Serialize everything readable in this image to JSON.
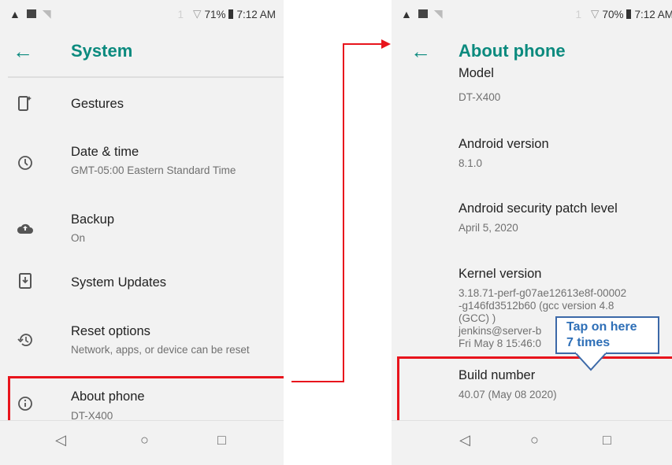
{
  "left_screen": {
    "status": {
      "battery": "71%",
      "time": "7:12 AM",
      "notif": "1"
    },
    "title": "System",
    "items": [
      {
        "icon": "gestures-icon",
        "title": "Gestures",
        "subtitle": ""
      },
      {
        "icon": "clock-icon",
        "title": "Date & time",
        "subtitle": "GMT-05:00 Eastern Standard Time"
      },
      {
        "icon": "cloud-upload-icon",
        "title": "Backup",
        "subtitle": "On"
      },
      {
        "icon": "system-update-icon",
        "title": "System Updates",
        "subtitle": ""
      },
      {
        "icon": "restore-icon",
        "title": "Reset options",
        "subtitle": "Network, apps, or device can be reset"
      },
      {
        "icon": "info-icon",
        "title": "About phone",
        "subtitle": "DT-X400"
      }
    ]
  },
  "right_screen": {
    "status": {
      "battery": "70%",
      "time": "7:12 AM",
      "notif": "1"
    },
    "title": "About phone",
    "model_label": "Model",
    "model_value": "DT-X400",
    "android_version_label": "Android version",
    "android_version_value": "8.1.0",
    "patch_label": "Android security patch level",
    "patch_value": "April 5, 2020",
    "kernel_label": "Kernel version",
    "kernel_lines": [
      "3.18.71-perf-g07ae12613e8f-00002",
      "-g146fd3512b60 (gcc version 4.8",
      "(GCC) )",
      "jenkins@server-b",
      "Fri May 8 15:46:0"
    ],
    "build_label": "Build number",
    "build_value": "40.07 (May 08 2020)"
  },
  "callout": {
    "line1": "Tap on here",
    "line2": "7 times"
  },
  "colors": {
    "accent": "#0b8a7e",
    "highlight": "#e8141c",
    "callout": "#3c69a8"
  }
}
